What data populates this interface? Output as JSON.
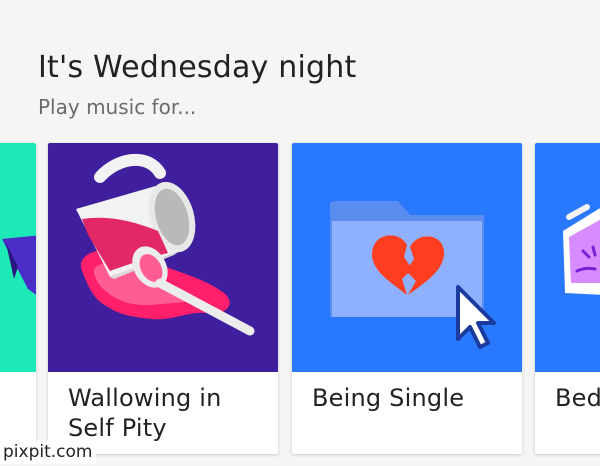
{
  "header": {
    "title": "It's Wednesday night",
    "subtitle": "Play music for..."
  },
  "cards": [
    {
      "label": "",
      "art_icon": "purple-shape-icon",
      "background": "#1de9b6"
    },
    {
      "label": "Wallowing in Self Pity",
      "art_icon": "spilled-cup-icon",
      "background": "#3f1f9e"
    },
    {
      "label": "Being Single",
      "art_icon": "folder-broken-heart-icon",
      "background": "#2979ff"
    },
    {
      "label": "Bed",
      "art_icon": "alarm-clock-icon",
      "background": "#2979ff"
    }
  ],
  "watermark": "pixpit.com"
}
